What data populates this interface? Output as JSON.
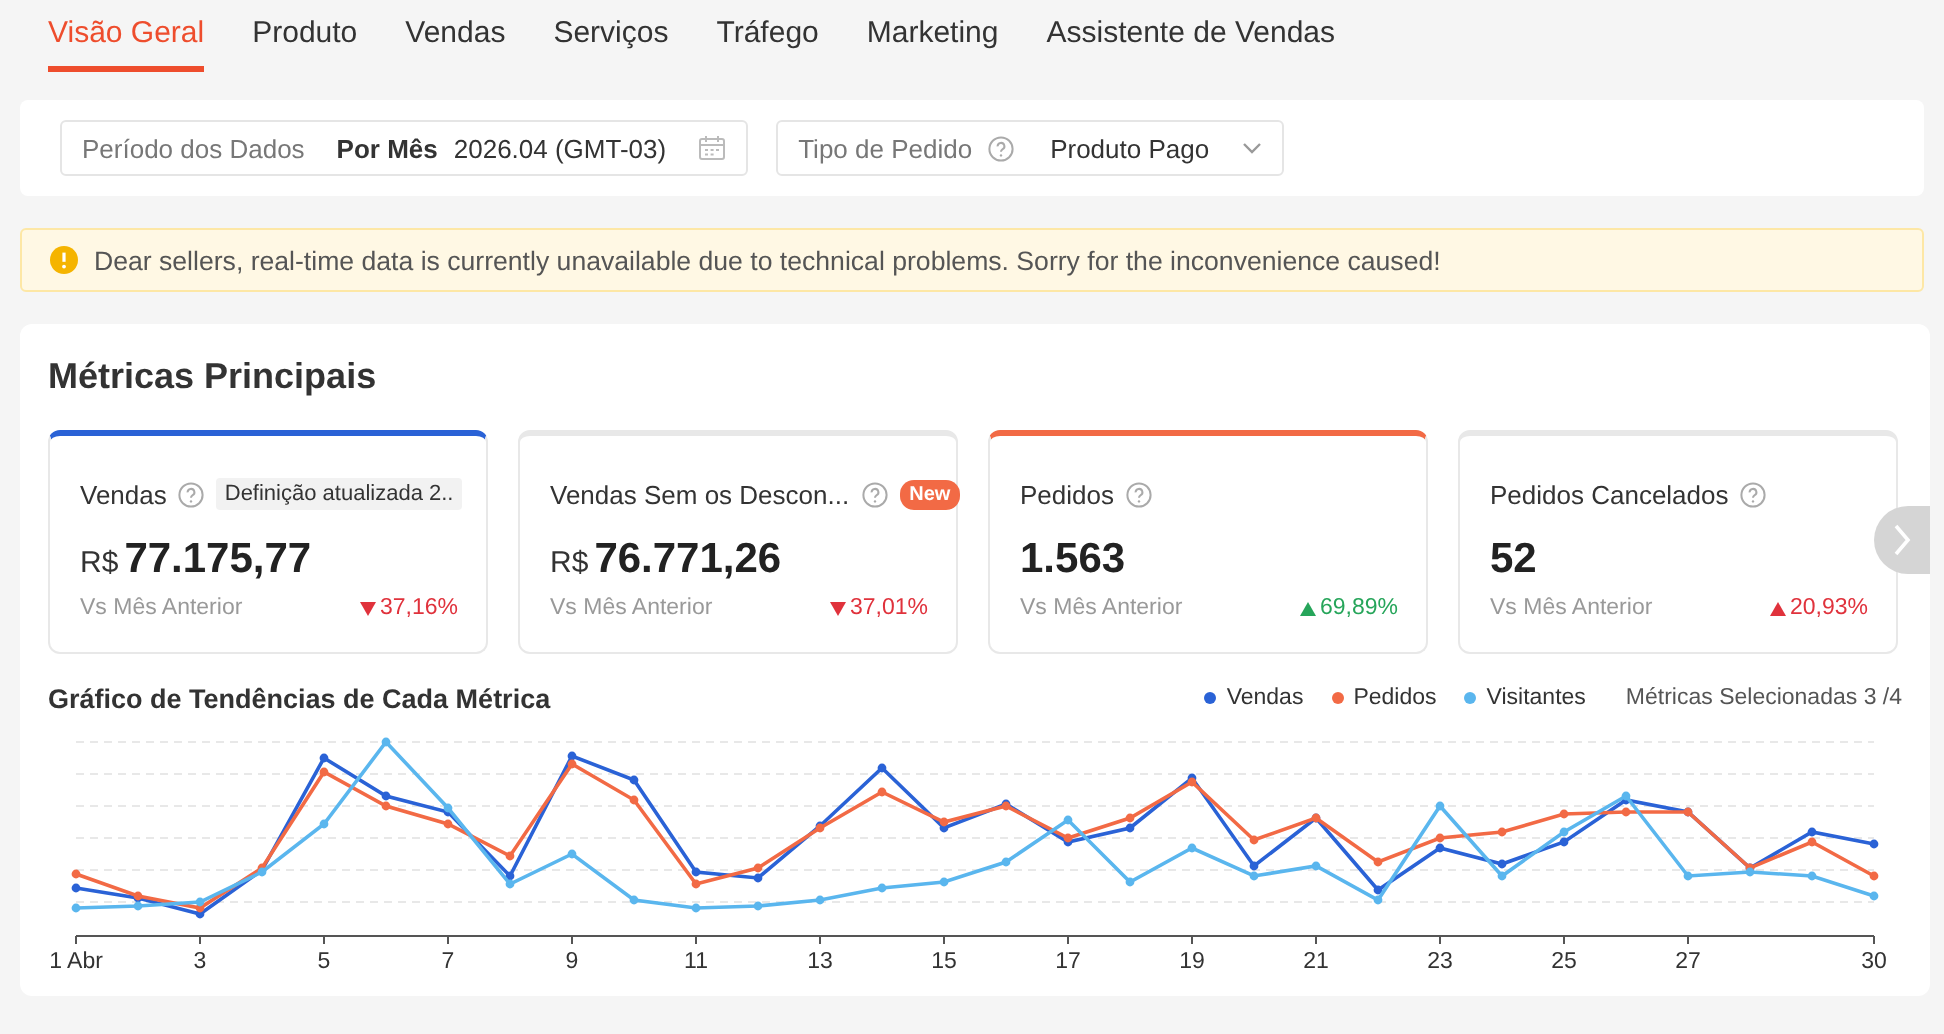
{
  "tabs": [
    {
      "label": "Visão Geral",
      "selected": true
    },
    {
      "label": "Produto",
      "selected": false
    },
    {
      "label": "Vendas",
      "selected": false
    },
    {
      "label": "Serviços",
      "selected": false
    },
    {
      "label": "Tráfego",
      "selected": false
    },
    {
      "label": "Marketing",
      "selected": false
    },
    {
      "label": "Assistente de Vendas",
      "selected": false
    }
  ],
  "filters": {
    "period_label": "Período dos Dados",
    "period_mode": "Por Mês",
    "period_value": "2026.04 (GMT-03)",
    "order_type_label": "Tipo de Pedido",
    "order_type_value": "Produto Pago"
  },
  "alert": {
    "text": "Dear sellers, real-time data is currently unavailable due to technical problems. Sorry for the inconvenience caused!"
  },
  "metrics": {
    "title": "Métricas Principais",
    "cards": [
      {
        "name": "Vendas",
        "tag": "Definição atualizada 2..",
        "currency": "R$",
        "value": "77.175,77",
        "compare": "Vs Mês Anterior",
        "change": "37,16%",
        "increase": false,
        "favorable": false,
        "selected": true,
        "color": "#2a62d6"
      },
      {
        "name": "Vendas Sem os Descon...",
        "badge": "New",
        "currency": "R$",
        "value": "76.771,26",
        "compare": "Vs Mês Anterior",
        "change": "37,01%",
        "increase": false,
        "favorable": false,
        "selected": false
      },
      {
        "name": "Pedidos",
        "value": "1.563",
        "compare": "Vs Mês Anterior",
        "change": "69,89%",
        "increase": true,
        "favorable": true,
        "selected": true,
        "color": "#f26a45"
      },
      {
        "name": "Pedidos Cancelados",
        "value": "52",
        "compare": "Vs Mês Anterior",
        "change": "20,93%",
        "increase": true,
        "favorable": false,
        "selected": false
      }
    ]
  },
  "trend_chart": {
    "title": "Gráfico de Tendências de Cada Métrica",
    "legend": [
      {
        "label": "Vendas",
        "color": "#2a62d6"
      },
      {
        "label": "Pedidos",
        "color": "#f26a45"
      },
      {
        "label": "Visitantes",
        "color": "#5ab6ee"
      }
    ],
    "selected_count": "Métricas Selecionadas 3 /4",
    "x_labels": [
      "1 Abr",
      "3",
      "5",
      "7",
      "9",
      "11",
      "13",
      "15",
      "17",
      "19",
      "21",
      "23",
      "25",
      "27",
      "30"
    ]
  }
}
